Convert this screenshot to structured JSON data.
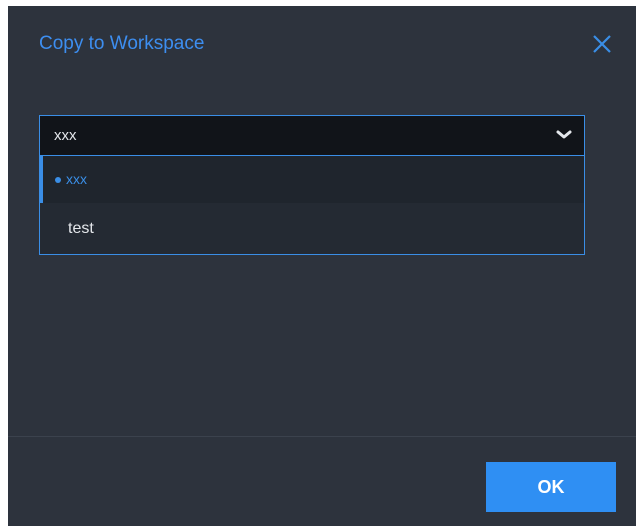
{
  "dialog": {
    "title": "Copy to Workspace",
    "close_icon": "close-icon",
    "select": {
      "value": "xxx",
      "chevron_icon": "chevron-down-icon"
    },
    "options": [
      {
        "label": "xxx",
        "selected": true
      },
      {
        "label": "test",
        "selected": false
      }
    ],
    "ok_label": "OK"
  },
  "colors": {
    "dialog_bg": "#2d333d",
    "accent": "#3a8ee6",
    "title": "#3d8ef0",
    "button": "#2f8ff3",
    "select_bg": "#111419",
    "dropdown_bg": "#242a33",
    "text": "#e4e7eb"
  }
}
